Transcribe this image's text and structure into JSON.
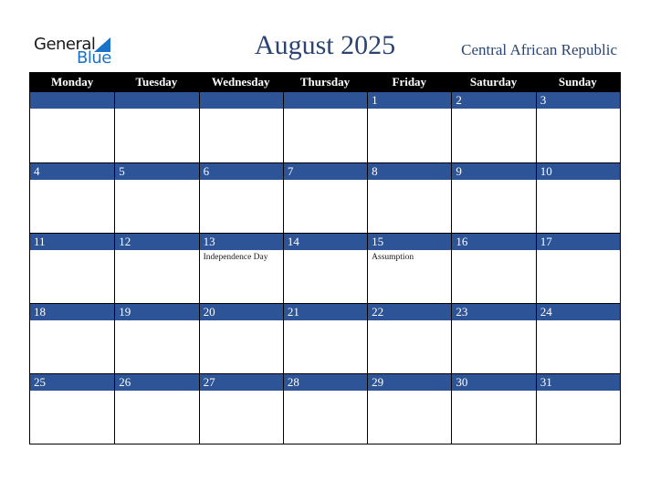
{
  "logo": {
    "line1": "General",
    "line2": "Blue",
    "icon": "triangle-flag-icon"
  },
  "header": {
    "title": "August 2025",
    "country": "Central African Republic"
  },
  "colors": {
    "title": "#2a4473",
    "day_bar": "#2d5496",
    "header_bg": "#000000",
    "logo_blue": "#1a73c7"
  },
  "calendar": {
    "weekdays": [
      "Monday",
      "Tuesday",
      "Wednesday",
      "Thursday",
      "Friday",
      "Saturday",
      "Sunday"
    ],
    "weeks": [
      [
        {
          "day": "",
          "holiday": ""
        },
        {
          "day": "",
          "holiday": ""
        },
        {
          "day": "",
          "holiday": ""
        },
        {
          "day": "",
          "holiday": ""
        },
        {
          "day": "1",
          "holiday": ""
        },
        {
          "day": "2",
          "holiday": ""
        },
        {
          "day": "3",
          "holiday": ""
        }
      ],
      [
        {
          "day": "4",
          "holiday": ""
        },
        {
          "day": "5",
          "holiday": ""
        },
        {
          "day": "6",
          "holiday": ""
        },
        {
          "day": "7",
          "holiday": ""
        },
        {
          "day": "8",
          "holiday": ""
        },
        {
          "day": "9",
          "holiday": ""
        },
        {
          "day": "10",
          "holiday": ""
        }
      ],
      [
        {
          "day": "11",
          "holiday": ""
        },
        {
          "day": "12",
          "holiday": ""
        },
        {
          "day": "13",
          "holiday": "Independence Day"
        },
        {
          "day": "14",
          "holiday": ""
        },
        {
          "day": "15",
          "holiday": "Assumption"
        },
        {
          "day": "16",
          "holiday": ""
        },
        {
          "day": "17",
          "holiday": ""
        }
      ],
      [
        {
          "day": "18",
          "holiday": ""
        },
        {
          "day": "19",
          "holiday": ""
        },
        {
          "day": "20",
          "holiday": ""
        },
        {
          "day": "21",
          "holiday": ""
        },
        {
          "day": "22",
          "holiday": ""
        },
        {
          "day": "23",
          "holiday": ""
        },
        {
          "day": "24",
          "holiday": ""
        }
      ],
      [
        {
          "day": "25",
          "holiday": ""
        },
        {
          "day": "26",
          "holiday": ""
        },
        {
          "day": "27",
          "holiday": ""
        },
        {
          "day": "28",
          "holiday": ""
        },
        {
          "day": "29",
          "holiday": ""
        },
        {
          "day": "30",
          "holiday": ""
        },
        {
          "day": "31",
          "holiday": ""
        }
      ]
    ]
  }
}
